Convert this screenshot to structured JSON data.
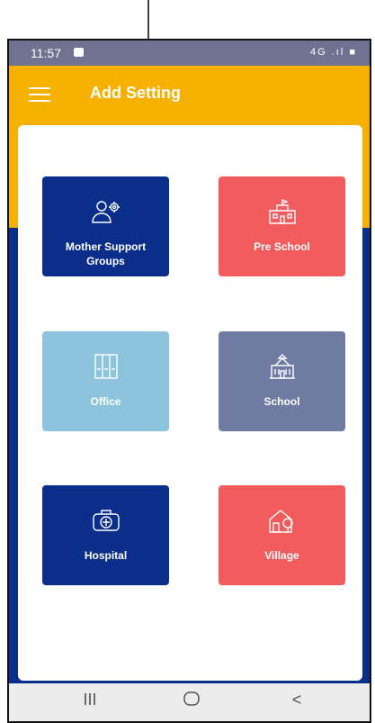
{
  "status_bar": {
    "time": "11:57",
    "right_text": "4G .ıl ■"
  },
  "app_bar": {
    "title": "Add Setting"
  },
  "tiles": [
    {
      "label": "Mother Support Groups",
      "color": "#0a2e8a",
      "icon": "people-gear-icon"
    },
    {
      "label": "Pre School",
      "color": "#f25c5c",
      "icon": "preschool-building-icon"
    },
    {
      "label": "Office",
      "color": "#8cc4de",
      "icon": "file-cabinet-icon"
    },
    {
      "label": "School",
      "color": "#6f7ba0",
      "icon": "school-building-icon"
    },
    {
      "label": "Hospital",
      "color": "#0a2e8a",
      "icon": "medical-kit-icon"
    },
    {
      "label": "Village",
      "color": "#f25c5c",
      "icon": "house-tree-icon"
    }
  ],
  "nav_bar": {
    "recents": "III",
    "home": "○",
    "back": "<"
  },
  "colors": {
    "accent": "#f5b000",
    "primary": "#0a2e8a",
    "status": "#6f7391"
  }
}
